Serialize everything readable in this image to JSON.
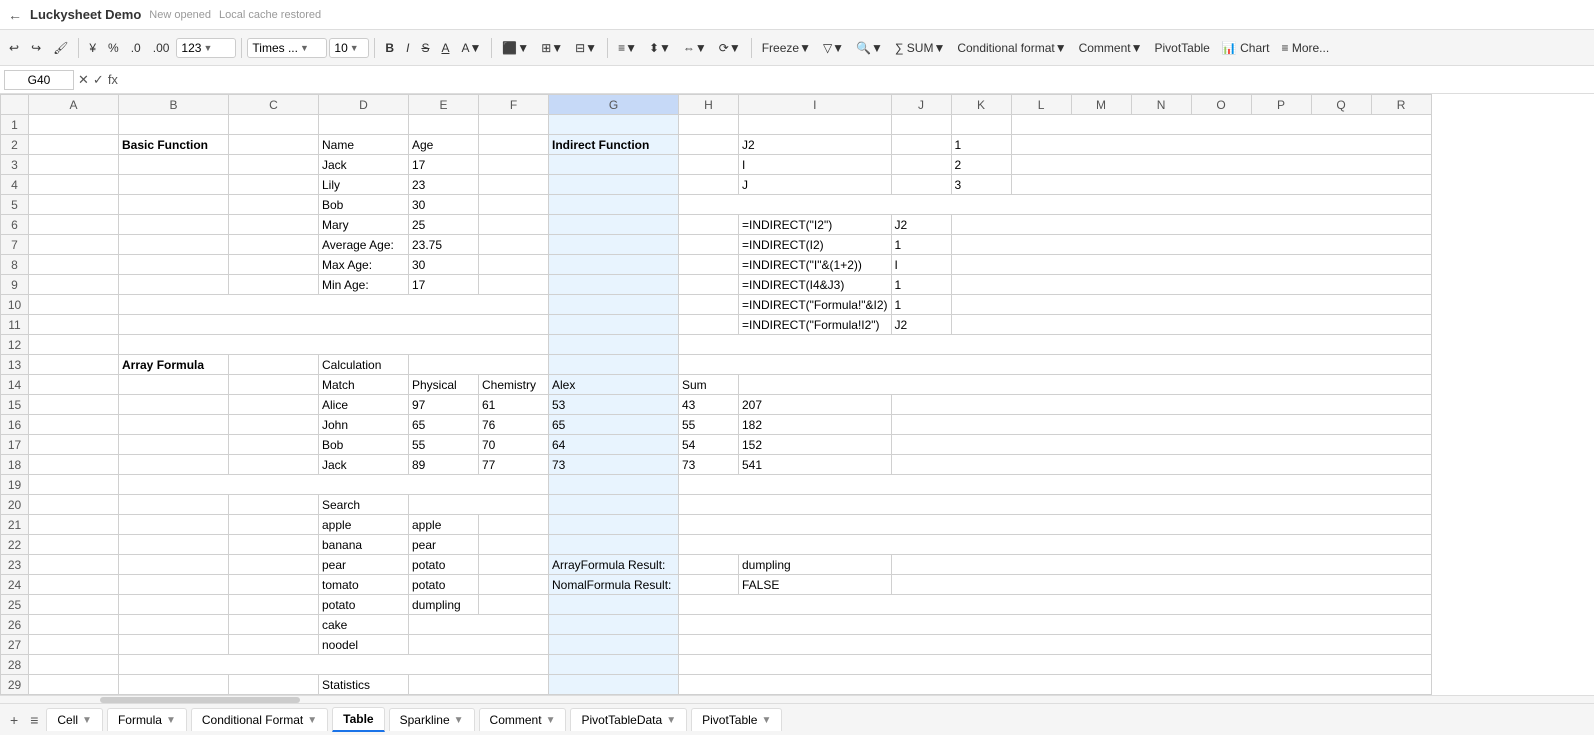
{
  "titleBar": {
    "backArrow": "←",
    "appTitle": "Luckysheet Demo",
    "newOpened": "New opened",
    "cacheRestored": "Local cache restored"
  },
  "toolbar": {
    "undo": "↩",
    "redo": "↪",
    "paintFormat": "🖌",
    "yuan": "¥",
    "percent": "%",
    "decimal0": ".0",
    "decimal2": ".00",
    "format123": "123",
    "fontFamily": "Times ...",
    "fontSize": "10",
    "bold": "B",
    "italic": "I",
    "strikethrough": "S",
    "underline": "A",
    "fontColor": "▼",
    "borders": "⊞",
    "mergeCenter": "⊟",
    "hAlign": "≡",
    "vAlign": "⬍",
    "textWrap": "⇔",
    "textRotate": "⟳",
    "fillColor": "A",
    "freeze": "Freeze",
    "filter": "▽",
    "sum": "∑ SUM",
    "conditionalFormat": "Conditional format",
    "comment": "Comment",
    "pivotTable": "PivotTable",
    "chart": "Chart",
    "more": "≡ More..."
  },
  "formulaBar": {
    "cellRef": "G40",
    "xIcon": "✕",
    "checkIcon": "✓",
    "fxIcon": "fx",
    "formulaValue": ""
  },
  "columns": [
    "",
    "A",
    "B",
    "C",
    "D",
    "E",
    "F",
    "G",
    "H",
    "I",
    "J",
    "K",
    "L",
    "M",
    "N",
    "O",
    "P",
    "Q",
    "R"
  ],
  "rows": [
    {
      "row": 1,
      "cells": [
        "",
        "",
        "",
        "",
        "",
        "",
        "",
        "",
        "",
        "",
        "",
        "",
        "",
        "",
        "",
        "",
        "",
        "",
        ""
      ]
    },
    {
      "row": 2,
      "cells": [
        "",
        "",
        "Basic Function",
        "",
        "Name",
        "Age",
        "",
        "",
        "Indirect Function",
        "",
        "J2",
        "",
        "1",
        "",
        "",
        "",
        "",
        "",
        ""
      ]
    },
    {
      "row": 3,
      "cells": [
        "",
        "",
        "",
        "",
        "Jack",
        "17",
        "",
        "",
        "",
        "",
        "I",
        "",
        "2",
        "",
        "",
        "",
        "",
        "",
        ""
      ]
    },
    {
      "row": 4,
      "cells": [
        "",
        "",
        "",
        "",
        "Lily",
        "23",
        "",
        "",
        "",
        "",
        "J",
        "",
        "3",
        "",
        "",
        "",
        "",
        "",
        ""
      ]
    },
    {
      "row": 5,
      "cells": [
        "",
        "",
        "",
        "",
        "Bob",
        "30",
        "",
        "",
        "",
        "",
        "",
        "",
        "",
        "",
        "",
        "",
        "",
        "",
        ""
      ]
    },
    {
      "row": 6,
      "cells": [
        "",
        "",
        "",
        "",
        "Mary",
        "25",
        "",
        "",
        "",
        "",
        "",
        "",
        "",
        "",
        "",
        "",
        "",
        "",
        ""
      ]
    },
    {
      "row": 7,
      "cells": [
        "",
        "",
        "",
        "",
        "Average Age:",
        "23.75",
        "",
        "",
        "",
        "",
        "",
        "",
        "",
        "",
        "",
        "",
        "",
        "",
        ""
      ]
    },
    {
      "row": 8,
      "cells": [
        "",
        "",
        "",
        "",
        "Max Age:",
        "30",
        "",
        "",
        "",
        "",
        "",
        "",
        "",
        "",
        "",
        "",
        "",
        "",
        ""
      ]
    },
    {
      "row": 9,
      "cells": [
        "",
        "",
        "",
        "",
        "Min Age:",
        "17",
        "",
        "",
        "",
        "",
        "",
        "",
        "",
        "",
        "",
        "",
        "",
        "",
        ""
      ]
    },
    {
      "row": 10,
      "cells": [
        "",
        "",
        "",
        "",
        "",
        "",
        "",
        "",
        "",
        "",
        "",
        "",
        "",
        "",
        "",
        "",
        "",
        "",
        ""
      ]
    },
    {
      "row": 11,
      "cells": [
        "",
        "",
        "",
        "",
        "",
        "",
        "",
        "",
        "",
        "",
        "",
        "",
        "",
        "",
        "",
        "",
        "",
        "",
        ""
      ]
    },
    {
      "row": 12,
      "cells": [
        "",
        "",
        "",
        "",
        "",
        "",
        "",
        "",
        "",
        "",
        "",
        "",
        "",
        "",
        "",
        "",
        "",
        "",
        ""
      ]
    },
    {
      "row": 13,
      "cells": [
        "",
        "",
        "Array Formula",
        "",
        "Calculation",
        "",
        "",
        "",
        "",
        "",
        "",
        "",
        "",
        "",
        "",
        "",
        "",
        "",
        ""
      ]
    },
    {
      "row": 14,
      "cells": [
        "",
        "",
        "",
        "",
        "Match",
        "Physical",
        "Chemistry",
        "Alex",
        "Sum",
        "",
        "",
        "",
        "",
        "",
        "",
        "",
        "",
        "",
        ""
      ]
    },
    {
      "row": 15,
      "cells": [
        "",
        "",
        "",
        "",
        "Alice",
        "97",
        "61",
        "53",
        "43",
        "207",
        "",
        "",
        "",
        "",
        "",
        "",
        "",
        "",
        ""
      ]
    },
    {
      "row": 16,
      "cells": [
        "",
        "",
        "",
        "",
        "John",
        "65",
        "76",
        "65",
        "55",
        "182",
        "",
        "",
        "",
        "",
        "",
        "",
        "",
        "",
        ""
      ]
    },
    {
      "row": 17,
      "cells": [
        "",
        "",
        "",
        "",
        "Bob",
        "55",
        "70",
        "64",
        "54",
        "152",
        "",
        "",
        "",
        "",
        "",
        "",
        "",
        "",
        ""
      ]
    },
    {
      "row": 18,
      "cells": [
        "",
        "",
        "",
        "",
        "Jack",
        "89",
        "77",
        "73",
        "73",
        "541",
        "",
        "",
        "",
        "",
        "",
        "",
        "",
        "",
        ""
      ]
    },
    {
      "row": 19,
      "cells": [
        "",
        "",
        "",
        "",
        "",
        "",
        "",
        "",
        "",
        "",
        "",
        "",
        "",
        "",
        "",
        "",
        "",
        "",
        ""
      ]
    },
    {
      "row": 20,
      "cells": [
        "",
        "",
        "",
        "",
        "Search",
        "",
        "",
        "",
        "",
        "",
        "",
        "",
        "",
        "",
        "",
        "",
        "",
        "",
        ""
      ]
    },
    {
      "row": 21,
      "cells": [
        "",
        "",
        "",
        "",
        "apple",
        "apple",
        "",
        "",
        "",
        "",
        "",
        "",
        "",
        "",
        "",
        "",
        "",
        "",
        ""
      ]
    },
    {
      "row": 22,
      "cells": [
        "",
        "",
        "",
        "",
        "banana",
        "pear",
        "",
        "",
        "",
        "",
        "",
        "",
        "",
        "",
        "",
        "",
        "",
        "",
        ""
      ]
    },
    {
      "row": 23,
      "cells": [
        "",
        "",
        "",
        "",
        "pear",
        "potato",
        "",
        "",
        "",
        "ArrayFormula Result:",
        "",
        "dumpling",
        "",
        "",
        "",
        "",
        "",
        "",
        ""
      ]
    },
    {
      "row": 24,
      "cells": [
        "",
        "",
        "",
        "",
        "tomato",
        "potato",
        "",
        "",
        "",
        "NomalFormula Result:",
        "",
        "FALSE",
        "",
        "",
        "",
        "",
        "",
        "",
        ""
      ]
    },
    {
      "row": 25,
      "cells": [
        "",
        "",
        "",
        "",
        "potato",
        "dumpling",
        "",
        "",
        "",
        "",
        "",
        "",
        "",
        "",
        "",
        "",
        "",
        "",
        ""
      ]
    },
    {
      "row": 26,
      "cells": [
        "",
        "",
        "",
        "",
        "cake",
        "",
        "",
        "",
        "",
        "",
        "",
        "",
        "",
        "",
        "",
        "",
        "",
        "",
        ""
      ]
    },
    {
      "row": 27,
      "cells": [
        "",
        "",
        "",
        "",
        "noodel",
        "",
        "",
        "",
        "",
        "",
        "",
        "",
        "",
        "",
        "",
        "",
        "",
        "",
        ""
      ]
    },
    {
      "row": 28,
      "cells": [
        "",
        "",
        "",
        "",
        "",
        "",
        "",
        "",
        "",
        "",
        "",
        "",
        "",
        "",
        "",
        "",
        "",
        "",
        ""
      ]
    },
    {
      "row": 29,
      "cells": [
        "",
        "",
        "",
        "",
        "Statistics",
        "",
        "",
        "",
        "",
        "",
        "",
        "",
        "",
        "",
        "",
        "",
        "",
        "",
        ""
      ]
    }
  ],
  "indirectRows": [
    {
      "row": 6,
      "formula": "=INDIRECT(\"I2\")",
      "result": "J2"
    },
    {
      "row": 7,
      "formula": "=INDIRECT(I2)",
      "result": "1"
    },
    {
      "row": 8,
      "formula": "=INDIRECT(\"I\"&(1+2))",
      "result": "I"
    },
    {
      "row": 9,
      "formula": "=INDIRECT(I4&J3)",
      "result": "1"
    },
    {
      "row": 10,
      "formula": "=INDIRECT(\"Formula!\"&I2)",
      "result": "1"
    },
    {
      "row": 11,
      "formula": "=INDIRECT(\"Formula!I2\")",
      "result": "J2"
    }
  ],
  "bottomTabs": {
    "addSheet": "+",
    "sheetMenu": "≡",
    "tabs": [
      {
        "label": "Cell",
        "active": false,
        "hasArrow": true
      },
      {
        "label": "Formula",
        "active": false,
        "hasArrow": true
      },
      {
        "label": "Conditional Format",
        "active": false,
        "hasArrow": true
      },
      {
        "label": "Table",
        "active": true,
        "hasArrow": false
      },
      {
        "label": "Sparkline",
        "active": false,
        "hasArrow": true
      },
      {
        "label": "Comment",
        "active": false,
        "hasArrow": true
      },
      {
        "label": "PivotTableData",
        "active": false,
        "hasArrow": true
      },
      {
        "label": "PivotTable",
        "active": false,
        "hasArrow": true
      }
    ]
  }
}
